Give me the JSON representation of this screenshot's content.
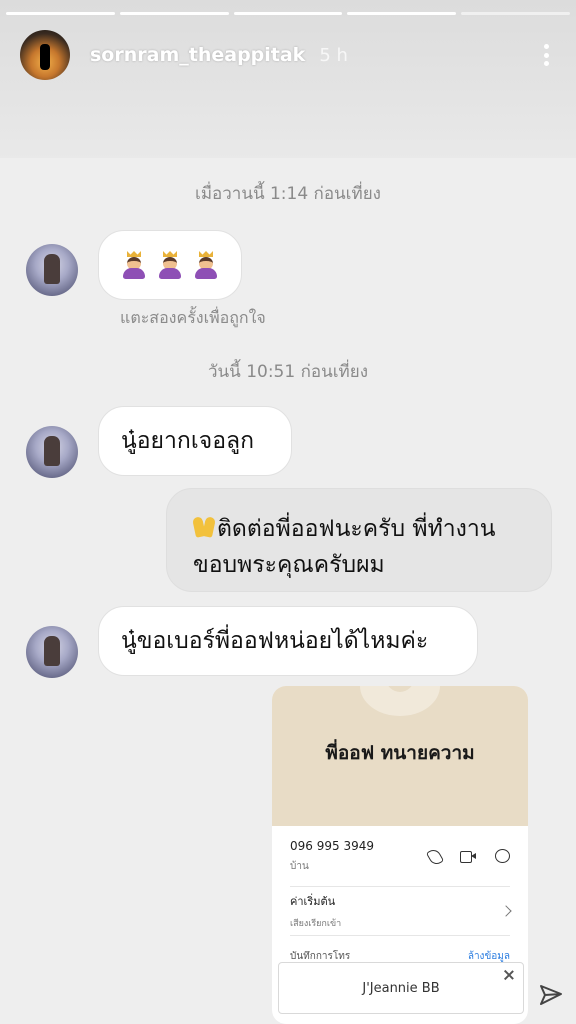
{
  "story": {
    "username": "sornram_theappitak",
    "time_ago": "5 h",
    "progress": [
      1,
      1,
      1,
      1,
      0.15
    ]
  },
  "chat": {
    "date_1": "เมื่อวานนี้ 1:14 ก่อนเที่ยง",
    "hint": "แตะสองครั้งเพื่อถูกใจ",
    "date_2": "วันนี้ 10:51 ก่อนเที่ยง",
    "msg_1": "นู๋อยากเจอลูก",
    "msg_2_line1": "ติดต่อพี่ออฟนะครับ พี่ทำงาน",
    "msg_2_line2": "ขอบพระคุณครับผม",
    "msg_3": "นู๋ขอเบอร์พี่ออฟหน่อยได้ไหมค่ะ"
  },
  "contact": {
    "name": "พี่ออฟ ทนายความ",
    "phone": "096 995 3949",
    "phone_label": "บ้าน",
    "ringtone_title": "ค่าเริ่มต้น",
    "ringtone_sub": "เสียงเรียกเข้า",
    "history_title": "บันทึกการโทร",
    "clear_label": "ล้างข้อมูล"
  },
  "toast": {
    "text": "J'Jeannie BB"
  },
  "icons": {
    "more": "more-vertical-icon",
    "send": "send-icon",
    "close": "close-icon"
  }
}
